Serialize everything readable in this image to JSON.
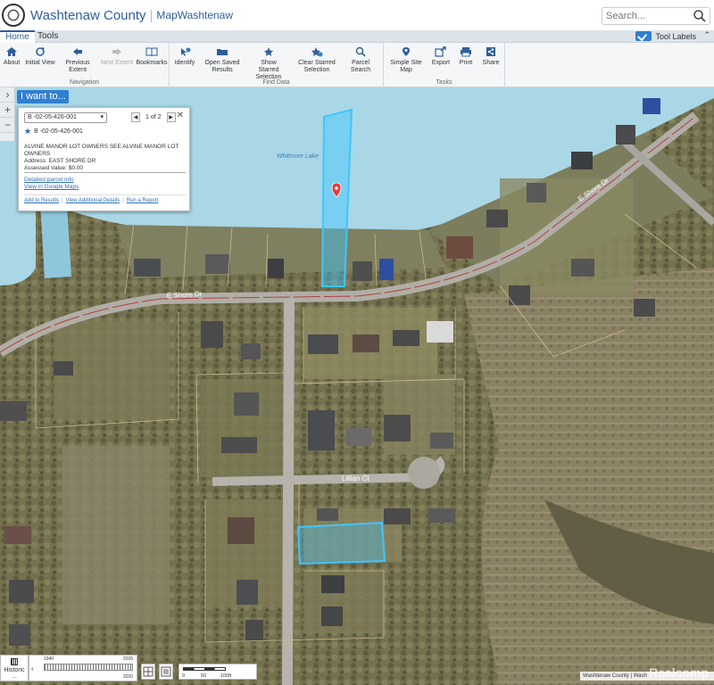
{
  "header": {
    "title": "Washtenaw County",
    "subtitle": "MapWashtenaw",
    "search_placeholder": "Search..."
  },
  "tabs": [
    {
      "label": "Home",
      "active": true
    },
    {
      "label": "Tools",
      "active": false
    }
  ],
  "tool_labels": {
    "label": "Tool Labels",
    "checked": true
  },
  "ribbon": {
    "navigation": {
      "label": "Navigation",
      "buttons": [
        {
          "label": "About",
          "icon": "home-icon"
        },
        {
          "label": "Initial View",
          "icon": "refresh-icon"
        },
        {
          "label": "Previous Extent",
          "icon": "arrow-left-icon"
        },
        {
          "label": "Next Extent",
          "icon": "arrow-right-icon",
          "disabled": true
        },
        {
          "label": "Bookmarks",
          "icon": "book-icon"
        }
      ]
    },
    "find_data": {
      "label": "Find Data",
      "buttons": [
        {
          "label": "Identify",
          "icon": "identify-icon"
        },
        {
          "label": "Open Saved Results",
          "icon": "folder-icon"
        },
        {
          "label": "Show Starred Selection",
          "icon": "star-icon"
        },
        {
          "label": "Clear Starred Selection",
          "icon": "star-clear-icon"
        },
        {
          "label": "Parcel Search",
          "icon": "search-icon"
        }
      ]
    },
    "tasks": {
      "label": "Tasks",
      "buttons": [
        {
          "label": "Simple Site Map",
          "icon": "map-pin-icon"
        },
        {
          "label": "Export",
          "icon": "export-icon"
        },
        {
          "label": "Print",
          "icon": "print-icon"
        },
        {
          "label": "Share",
          "icon": "share-icon"
        }
      ]
    }
  },
  "i_want_to": "I want to...",
  "popup": {
    "selected_parcel": "B -02-05-426-001",
    "pager": "1 of 2",
    "parcel_id": "B -02-05-426-001",
    "owner_line": "ALVINE MANOR LOT OWNERS  SEE ALVINE MANOR LOT OWNERS",
    "address": "Address: EAST SHORE DR",
    "assessed": "Assessed Value: $0.00",
    "detailed_link": "Detailed parcel info",
    "google_link": "View in Google Maps",
    "actions": [
      "Add to Results",
      "View Additional Details",
      "Run a Report"
    ]
  },
  "map_labels": {
    "lake": "Whitmore Lake",
    "road_e_shore_1": "E Shore Dr",
    "road_e_shore_2": "E Shore Dr",
    "road_lillian": "Lillian Ct"
  },
  "historic": {
    "label": "Historic ...",
    "year_start": "1940",
    "year_end": "2020",
    "year_top_right": "2020"
  },
  "scalebar": {
    "labels": [
      "0",
      "50",
      "100ft"
    ]
  },
  "attribution": "Washtenaw County | Wash",
  "watermark": "Realcomp",
  "colors": {
    "accent": "#2f7fd1",
    "brand": "#2f5f99",
    "parcel_highlight": "#3ec6ff",
    "lake": "#a9d7e6",
    "parcel_lines": "#c9b98d",
    "road_line": "#b04040"
  }
}
